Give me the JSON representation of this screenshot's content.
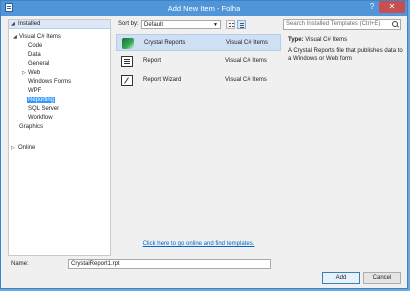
{
  "window": {
    "title": "Add New Item - Folha",
    "help_label": "?",
    "close_label": "✕"
  },
  "tree": {
    "installed": "Installed",
    "visual_csharp": "Visual C# Items",
    "children": [
      "Code",
      "Data",
      "General",
      "Web",
      "Windows Forms",
      "WPF",
      "Reporting",
      "SQL Server",
      "Workflow"
    ],
    "graphics": "Graphics",
    "online": "Online"
  },
  "toolbar": {
    "sort_label": "Sort by:",
    "sort_value": "Default",
    "search_placeholder": "Search Installed Templates (Ctrl+E)"
  },
  "templates": [
    {
      "name": "Crystal Reports",
      "type": "Visual C# Items",
      "icon": "crystal-reports-icon"
    },
    {
      "name": "Report",
      "type": "Visual C# Items",
      "icon": "report-icon"
    },
    {
      "name": "Report Wizard",
      "type": "Visual C# Items",
      "icon": "report-wizard-icon"
    }
  ],
  "details": {
    "type_label": "Type:",
    "type_value": "Visual C# Items",
    "description": "A Crystal Reports file that publishes data to a Windows or Web form"
  },
  "online_link": "Click here to go online and find templates.",
  "name_field": {
    "label": "Name:",
    "value": "CrystalReport1.rpt"
  },
  "buttons": {
    "add": "Add",
    "cancel": "Cancel"
  },
  "colors": {
    "titlebar": "#4f95d8",
    "selection": "#3399ff",
    "selected_row": "#cfe0f5",
    "link": "#0066cc"
  }
}
